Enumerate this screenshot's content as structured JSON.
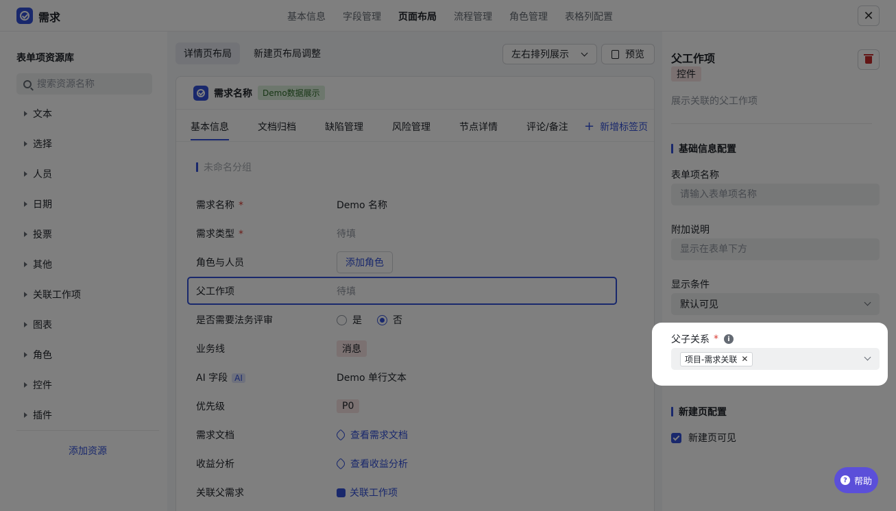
{
  "app": {
    "title": "需求",
    "close_label": "✕"
  },
  "top_tabs": [
    "基本信息",
    "字段管理",
    "页面布局",
    "流程管理",
    "角色管理",
    "表格列配置"
  ],
  "left": {
    "title": "表单项资源库",
    "search_placeholder": "搜索资源名称",
    "items": [
      "文本",
      "选择",
      "人员",
      "日期",
      "投票",
      "其他",
      "关联工作项",
      "图表",
      "角色",
      "控件",
      "插件"
    ],
    "add_label": "添加资源"
  },
  "center": {
    "seg_tabs": [
      "详情页布局",
      "新建页布局调整"
    ],
    "layout_select": "左右排列展示",
    "preview_label": "预览",
    "card_title": "需求名称",
    "demo_badge": "Demo数据展示",
    "card_tabs": [
      "基本信息",
      "文档归档",
      "缺陷管理",
      "风险管理",
      "节点详情",
      "评论/备注"
    ],
    "new_tab_label": "新增标签页",
    "group_name": "未命名分组",
    "fields": {
      "name": {
        "label": "需求名称",
        "required": "*",
        "value": "Demo 名称"
      },
      "type": {
        "label": "需求类型",
        "required": "*",
        "value": "待填"
      },
      "role": {
        "label": "角色与人员",
        "value": "添加角色"
      },
      "parent": {
        "label": "父工作项",
        "value": "待填"
      },
      "legal": {
        "label": "是否需要法务评审",
        "yes": "是",
        "no": "否"
      },
      "biz": {
        "label": "业务线",
        "value": "消息"
      },
      "ai": {
        "label": "AI 字段",
        "tag": "AI",
        "value": "Demo 单行文本"
      },
      "priority": {
        "label": "优先级",
        "value": "P0"
      },
      "doc": {
        "label": "需求文档",
        "value": "查看需求文档"
      },
      "profit": {
        "label": "收益分析",
        "value": "查看收益分析"
      },
      "parent_req": {
        "label": "关联父需求",
        "value": "关联工作项"
      }
    }
  },
  "right": {
    "title": "父工作项",
    "tag": "控件",
    "desc": "展示关联的父工作项",
    "basic_section": "基础信息配置",
    "name_label": "表单项名称",
    "name_placeholder": "请输入表单项名称",
    "extra_label": "附加说明",
    "extra_placeholder": "显示在表单下方",
    "cond_label": "显示条件",
    "cond_value": "默认可见",
    "relation_label": "父子关系",
    "relation_required": "*",
    "relation_chip": "项目-需求关联",
    "new_section": "新建页配置",
    "new_visible_label": "新建页可见"
  },
  "help_label": "帮助",
  "colors": {
    "accent": "#3250d9",
    "required": "#d83931",
    "help": "#5b4fd9"
  }
}
